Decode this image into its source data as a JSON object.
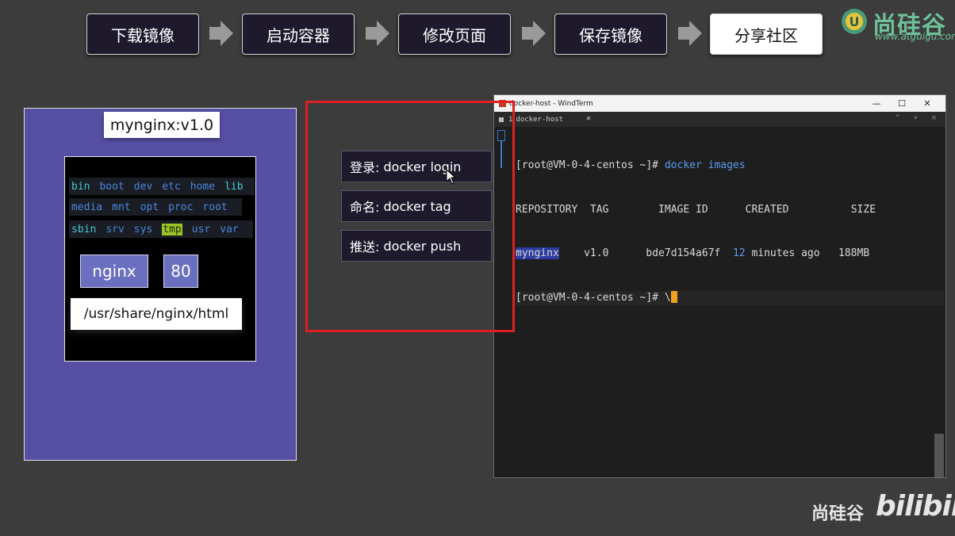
{
  "workflow": {
    "steps": [
      "下载镜像",
      "启动容器",
      "修改页面",
      "保存镜像",
      "分享社区"
    ],
    "active_index": 4
  },
  "logo": {
    "text": "尚硅谷",
    "url": "www.atguigu.com",
    "badge": "U"
  },
  "container_panel": {
    "image_name": "mynginx:v1.0",
    "fs_rows": [
      [
        "bin",
        "boot",
        "dev",
        "etc",
        "home",
        "lib"
      ],
      [
        "media",
        "mnt",
        "opt",
        "proc",
        "root"
      ],
      [
        "sbin",
        "srv",
        "sys",
        "tmp",
        "usr",
        "var"
      ]
    ],
    "highlighted_dir": "tmp",
    "app_chip": "nginx",
    "port_chip": "80",
    "html_path": "/usr/share/nginx/html"
  },
  "commands": [
    {
      "label": "登录:",
      "cmd": "docker login"
    },
    {
      "label": "命名:",
      "cmd": "docker tag"
    },
    {
      "label": "推送:",
      "cmd": "docker push"
    }
  ],
  "terminal": {
    "window_title": "docker-host - WindTerm",
    "tab_label": "docker-host",
    "tab_index": "1",
    "controls": {
      "minimize": "—",
      "maximize": "☐",
      "close": "✕"
    },
    "tab_tools": "^ + ≡",
    "prompt": "[root@VM-0-4-centos ~]#",
    "command": "docker images",
    "headers": [
      "REPOSITORY",
      "TAG",
      "IMAGE ID",
      "CREATED",
      "SIZE"
    ],
    "rows": [
      {
        "repository": "mynginx",
        "tag": "v1.0",
        "image_id": "bde7d154a67f",
        "created_num": "12",
        "created_rest": "minutes ago",
        "size": "188MB"
      }
    ],
    "second_prompt": "[root@VM-0-4-centos ~]#",
    "second_input": "\\"
  },
  "watermark": {
    "left": "尚硅谷",
    "right": "bilibili"
  },
  "colors": {
    "panel": "#574fa4",
    "highlight_box": "#e02020",
    "terminal_bg": "#1e1e1e",
    "prompt_blue": "#5a9cf0"
  }
}
